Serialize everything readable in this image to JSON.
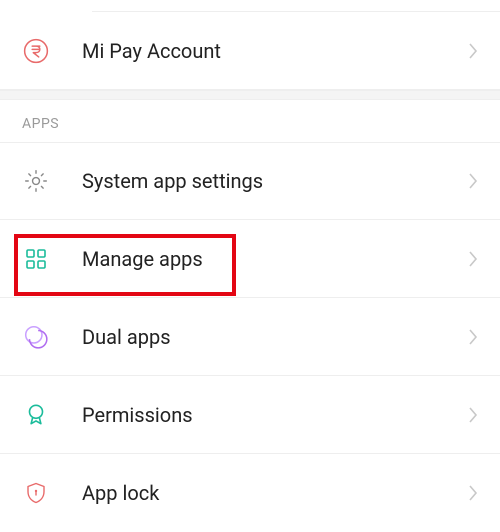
{
  "accounts": {
    "mi_pay": {
      "label": "Mi Pay Account"
    }
  },
  "apps_section": {
    "header": "APPS",
    "system_app_settings": {
      "label": "System app settings"
    },
    "manage_apps": {
      "label": "Manage apps"
    },
    "dual_apps": {
      "label": "Dual apps"
    },
    "permissions": {
      "label": "Permissions"
    },
    "app_lock": {
      "label": "App lock"
    }
  }
}
